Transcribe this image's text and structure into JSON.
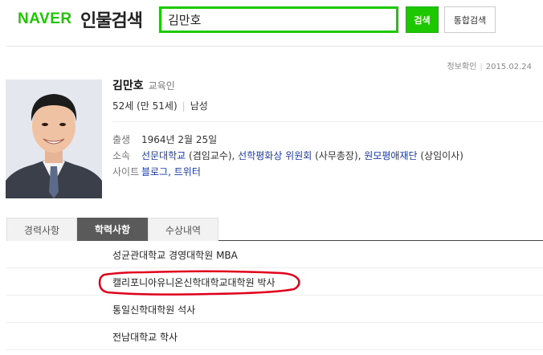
{
  "header": {
    "logo": "NAVER",
    "service": "인물검색",
    "search_value": "김만호",
    "search_button": "검색",
    "integrated_button": "통합검색"
  },
  "meta": {
    "verify_label": "정보확인",
    "date": "2015.02.24"
  },
  "profile": {
    "name": "김만호",
    "job": "교육인",
    "age": "52세 (만 51세)",
    "gender": "남성",
    "birth_label": "출생",
    "birth_value": "1964년 2월 25일",
    "affiliation_label": "소속",
    "affiliations": [
      {
        "org": "선문대학교",
        "role": " (겸임교수), "
      },
      {
        "org": "선학평화상 위원회",
        "role": " (사무총장), "
      },
      {
        "org": "원모평애재단",
        "role": " (상임이사)"
      }
    ],
    "site_label": "사이트",
    "sites": [
      "블로그",
      "트위터"
    ],
    "site_sep": ", "
  },
  "tabs": [
    {
      "label": "경력사항",
      "active": false
    },
    {
      "label": "학력사항",
      "active": true
    },
    {
      "label": "수상내역",
      "active": false
    }
  ],
  "education": [
    "성균관대학교 경영대학원 MBA",
    "캘리포니아유니온신학대학교대학원 박사",
    "통일신학대학원 석사",
    "전남대학교 학사"
  ],
  "colors": {
    "brand_green": "#1ec800",
    "link_blue": "#1a3aa8",
    "highlight_red": "#e0001b"
  }
}
